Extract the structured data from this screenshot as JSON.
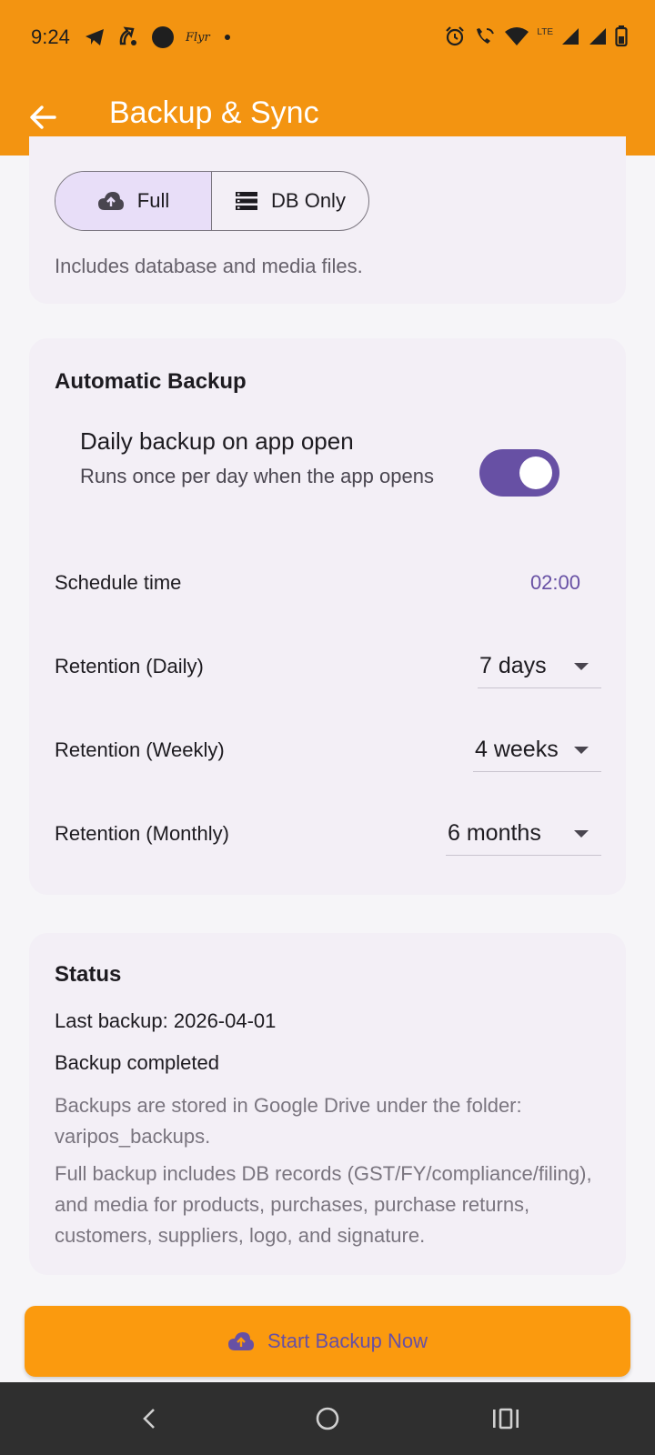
{
  "status_bar": {
    "time": "9:24",
    "carrier": "Flyr",
    "network": "LTE",
    "left_icons": [
      "telegram-icon",
      "call-forward-icon",
      "circle-dot-icon",
      "dot-icon"
    ],
    "right_icons": [
      "alarm-icon",
      "wifi-call-icon",
      "wifi-icon",
      "signal-icon",
      "signal-icon",
      "battery-icon"
    ]
  },
  "app_bar": {
    "title": "Backup & Sync",
    "back_icon": "arrow-left-icon"
  },
  "backup_mode": {
    "options": [
      "Full",
      "DB Only"
    ],
    "selected": "Full",
    "description": "Includes database and media files."
  },
  "automatic_backup": {
    "title": "Automatic Backup",
    "daily_switch": {
      "label": "Daily backup on app open",
      "sublabel": "Runs once per day when the app opens",
      "enabled": true
    },
    "schedule_label": "Schedule time",
    "schedule_value": "02:00",
    "retention_daily": {
      "label": "Retention (Daily)",
      "value": "7 days"
    },
    "retention_weekly": {
      "label": "Retention (Weekly)",
      "value": "4 weeks"
    },
    "retention_monthly": {
      "label": "Retention (Monthly)",
      "value": "6 months"
    }
  },
  "status": {
    "title": "Status",
    "last_backup": "Last backup: 2026-04-01",
    "message": "Backup completed",
    "note_storage": "Backups are stored in Google Drive under the folder: varipos_backups.",
    "note_full": "Full backup includes DB records (GST/FY/compliance/filing), and media for products, purchases, purchase returns, customers, suppliers, logo, and signature."
  },
  "cta": {
    "label": "Start Backup Now",
    "icon": "cloud-upload-icon"
  },
  "colors": {
    "primary_orange": "#f39411",
    "button_orange": "#fb9a0e",
    "accent_purple": "#6750a4",
    "segment_selected": "#e8def8"
  }
}
